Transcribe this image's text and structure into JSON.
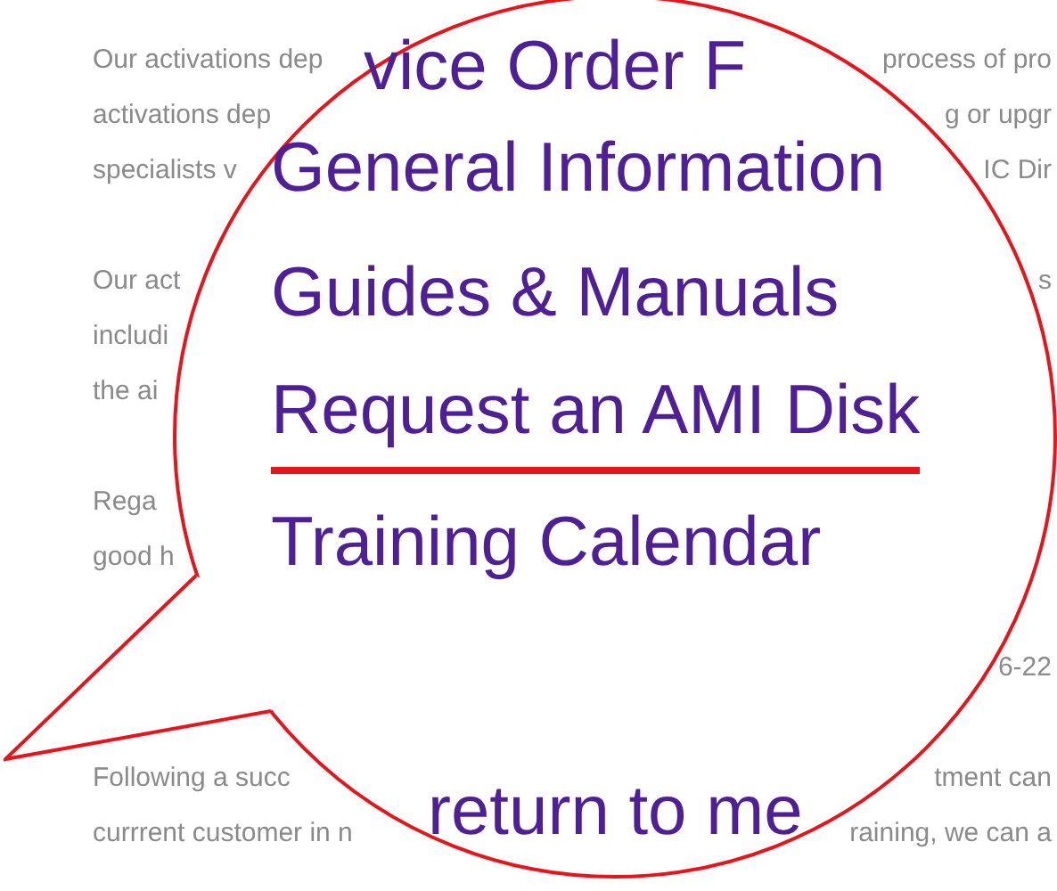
{
  "article": {
    "paragraphs": [
      {
        "lines": [
          {
            "left": "Our activations dep",
            "right": "process of pro"
          },
          {
            "left": "activations dep",
            "right": "g or upgr"
          },
          {
            "left": "specialists v",
            "right": "IC Dir"
          }
        ]
      },
      {
        "lines": [
          {
            "left": "Our act",
            "right": "s"
          },
          {
            "left": "includi"
          },
          {
            "left": "the ai"
          }
        ]
      },
      {
        "lines": [
          {
            "left": "Rega"
          },
          {
            "left": "good h"
          }
        ]
      },
      {
        "lines": [
          {
            "right": "6-22"
          }
        ]
      },
      {
        "lines": [
          {
            "left": "Following a succ",
            "right": "tment can"
          },
          {
            "left": "currrent customer in n",
            "right": "raining, we can a"
          }
        ]
      }
    ]
  },
  "magnifier": {
    "heading": "vice Order F",
    "menu": [
      {
        "text": "General Information",
        "selected": false
      },
      {
        "text": "Guides & Manuals",
        "selected": false
      },
      {
        "text": "Request an AMI Disk",
        "selected": true
      },
      {
        "text": "Training Calendar",
        "selected": false
      }
    ],
    "return_link": "return to me"
  }
}
